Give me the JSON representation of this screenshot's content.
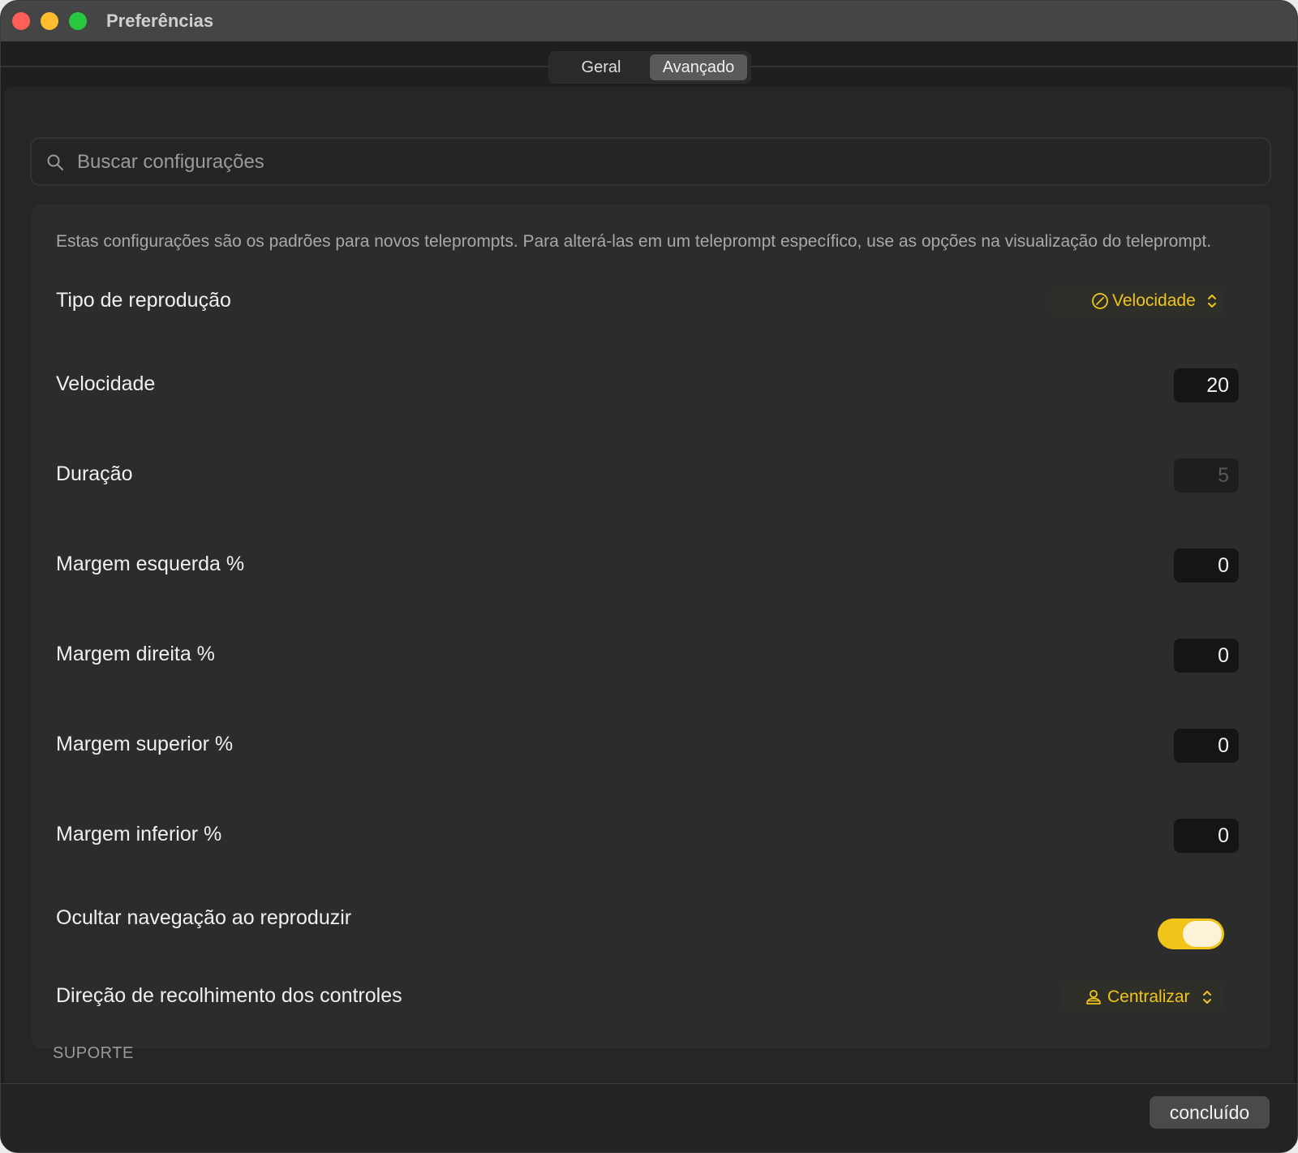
{
  "window": {
    "title": "Preferências"
  },
  "tabs": [
    {
      "label": "Geral",
      "active": false
    },
    {
      "label": "Avançado",
      "active": true
    }
  ],
  "search": {
    "placeholder": "Buscar configurações"
  },
  "settings": {
    "description": "Estas configurações são os padrões para novos teleprompts. Para alterá-las em um teleprompt específico, use as opções na visualização do teleprompt.",
    "playback_type": {
      "label": "Tipo de reprodução",
      "value": "Velocidade",
      "icon": "speedometer-icon"
    },
    "speed": {
      "label": "Velocidade",
      "value": "20"
    },
    "duration": {
      "label": "Duração",
      "value": "5",
      "disabled": true
    },
    "margin_left": {
      "label": "Margem esquerda %",
      "value": "0"
    },
    "margin_right": {
      "label": "Margem direita %",
      "value": "0"
    },
    "margin_top": {
      "label": "Margem superior %",
      "value": "0"
    },
    "margin_bottom": {
      "label": "Margem inferior %",
      "value": "0"
    },
    "hide_nav": {
      "label": "Ocultar navegação ao reproduzir",
      "on": true
    },
    "collapse_direction": {
      "label": "Direção de recolhimento dos controles",
      "value": "Centralizar",
      "icon": "person-center-icon"
    }
  },
  "support": {
    "header": "SUPORTE"
  },
  "footer": {
    "done_label": "concluído"
  },
  "colors": {
    "accent": "#f0c419",
    "background": "#1f1f1f",
    "card": "#2c2c2c"
  }
}
